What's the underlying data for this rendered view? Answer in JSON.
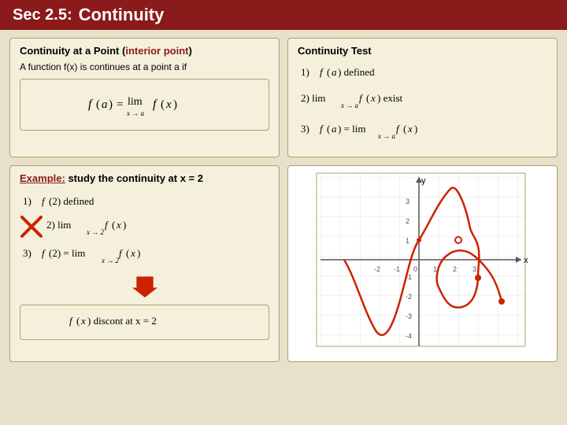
{
  "header": {
    "sec_label": "Sec 2.5:",
    "title": "Continuity"
  },
  "card_continuity_point": {
    "heading": "Continuity at a Point (",
    "heading_interior": "interior point",
    "heading_end": ")",
    "description": "A  function  f(x)  is continues at a point  a  if"
  },
  "card_continuity_test": {
    "heading": "Continuity Test",
    "items": [
      "1) f(a)  defined",
      "2) lim f(x)  exist",
      "3) f(a) = lim f(x)"
    ]
  },
  "card_example": {
    "label": "Example:",
    "description": "study the continuity at  x = 2",
    "steps": [
      "1) f(2)  defined",
      "2) lim f(x)",
      "3) f(2) = lim f(x)"
    ],
    "conclusion": "f(x)  discont  at  x = 2"
  },
  "graph": {
    "label": "function graph"
  }
}
